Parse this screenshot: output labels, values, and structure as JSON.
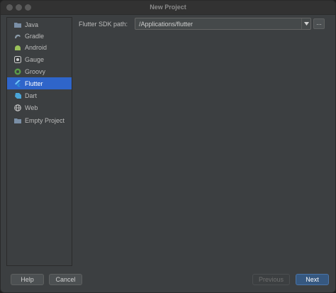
{
  "window": {
    "title": "New Project"
  },
  "sidebar": {
    "items": [
      {
        "label": "Java",
        "icon": "folder-icon",
        "selected": false
      },
      {
        "label": "Gradle",
        "icon": "gradle-icon",
        "selected": false
      },
      {
        "label": "Android",
        "icon": "android-icon",
        "selected": false
      },
      {
        "label": "Gauge",
        "icon": "gauge-icon",
        "selected": false
      },
      {
        "label": "Groovy",
        "icon": "groovy-icon",
        "selected": false
      },
      {
        "label": "Flutter",
        "icon": "flutter-icon",
        "selected": true
      },
      {
        "label": "Dart",
        "icon": "dart-icon",
        "selected": false
      },
      {
        "label": "Web",
        "icon": "globe-icon",
        "selected": false
      },
      {
        "label": "Empty Project",
        "icon": "folder-icon",
        "selected": false
      }
    ]
  },
  "main": {
    "sdk_label": "Flutter SDK path:",
    "sdk_value": "/Applications/flutter",
    "browse_label": "..."
  },
  "buttons": {
    "help": "Help",
    "cancel": "Cancel",
    "previous": "Previous",
    "next": "Next"
  },
  "colors": {
    "background": "#3c3f41",
    "selection": "#2f65ca",
    "primary_button": "#365880"
  }
}
